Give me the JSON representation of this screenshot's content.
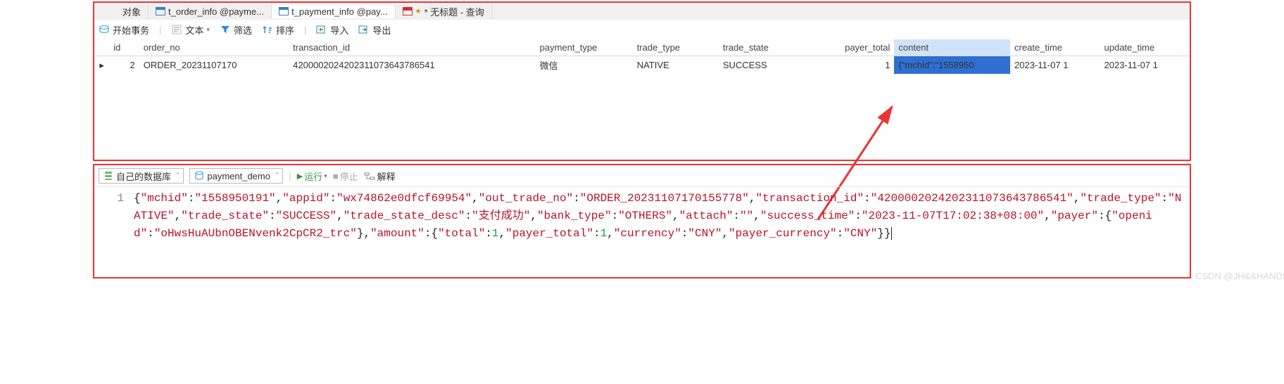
{
  "tabs": {
    "t0": "对象",
    "t1": "t_order_info @payme...",
    "t2": "t_payment_info @pay...",
    "t3": "* 无标题 - 查询"
  },
  "toolbar_top": {
    "begin_tx": "开始事务",
    "text": "文本",
    "filter": "筛选",
    "sort": "排序",
    "import": "导入",
    "export": "导出"
  },
  "grid": {
    "headers": [
      "id",
      "order_no",
      "transaction_id",
      "payment_type",
      "trade_type",
      "trade_state",
      "payer_total",
      "content",
      "create_time",
      "update_time"
    ],
    "row": {
      "marker": "▸",
      "id": "2",
      "order_no": "ORDER_20231107170",
      "transaction_id": "4200002024202311073643786541",
      "payment_type": "微信",
      "trade_type": "NATIVE",
      "trade_state": "SUCCESS",
      "payer_total": "1",
      "content": "{\"mchid\":\"1558950",
      "create_time": "2023-11-07 1",
      "update_time": "2023-11-07 1"
    }
  },
  "query_toolbar": {
    "conn": "自己的数据库",
    "db": "payment_demo",
    "run": "运行",
    "stop": "停止",
    "explain": "解释"
  },
  "code": {
    "line_no": "1",
    "json": {
      "mchid": "1558950191",
      "appid": "wx74862e0dfcf69954",
      "out_trade_no": "ORDER_20231107170155778",
      "transaction_id": "4200002024202311073643786541",
      "trade_type": "NATIVE",
      "trade_state": "SUCCESS",
      "trade_state_desc": "支付成功",
      "bank_type": "OTHERS",
      "attach": "",
      "success_time": "2023-11-07T17:02:38+08:00",
      "payer": {
        "openid": "oHwsHuAUbnOBENvenk2CpCR2_trc"
      },
      "amount": {
        "total": 1,
        "payer_total": 1,
        "currency": "CNY",
        "payer_currency": "CNY"
      }
    }
  },
  "watermark": "CSDN @JH&&HANDSOME"
}
